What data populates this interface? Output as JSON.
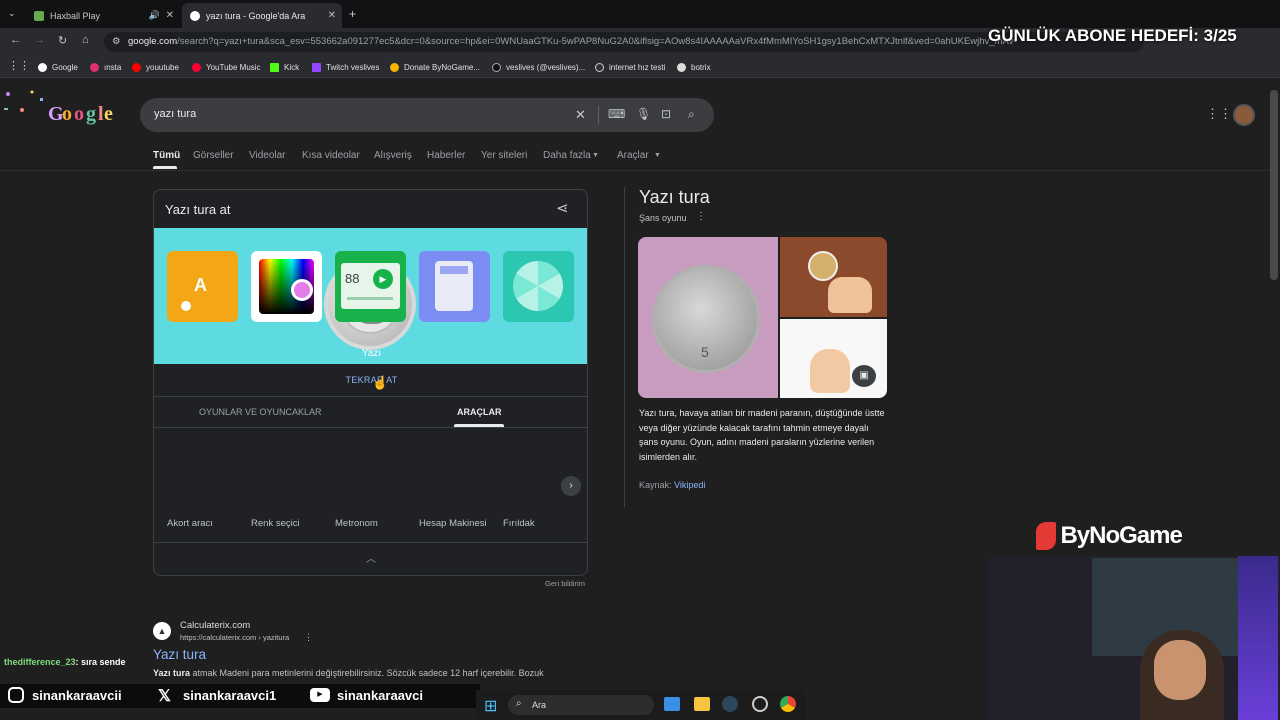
{
  "tabs": [
    {
      "title": "Haxball Play"
    },
    {
      "title": "yazı tura - Google'da Ara"
    }
  ],
  "address": {
    "domain": "google.com",
    "path": "/search?q=yazı+tura&sca_esv=553662a091277ec5&dcr=0&source=hp&ei=0WNUaaGTKu-5wPAP8NuG2A0&iflsig=AOw8s4IAAAAAaVRx4fMmMIYoSH1gsy1BehCxMTXJtnlf&ved=0ahUKEwjhv_mAv-"
  },
  "bookmarks": [
    "Google",
    "ınsta",
    "youutube",
    "YouTube Music",
    "Kick",
    "Twitch veslives",
    "Donate ByNoGame...",
    "veslives (@veslives)...",
    "internet hız testi",
    "botrix"
  ],
  "overlay": {
    "goal": "GÜNLÜK ABONE HEDEFİ: 3/25",
    "brand": "ByNoGame",
    "chat_user": "thedifference_23",
    "chat_msg": ": sıra sende"
  },
  "search": {
    "query": "yazı tura"
  },
  "nav_tabs": [
    "Tümü",
    "Görseller",
    "Videolar",
    "Kısa videolar",
    "Alışveriş",
    "Haberler",
    "Yer siteleri",
    "Daha fazla",
    "Araçlar"
  ],
  "coin_card": {
    "title": "Yazı tura at",
    "result": "Yazı",
    "flip_button": "TEKRAR AT",
    "tab_games": "OYUNLAR VE OYUNCAKLAR",
    "tab_tools": "ARAÇLAR",
    "tools": [
      "Akort aracı",
      "Renk seçici",
      "Metronom",
      "Hesap Makinesi",
      "Fırıldak"
    ],
    "metronome_value": "88",
    "tuner_letter": "A",
    "feedback": "Geri bildirim"
  },
  "knowledge_panel": {
    "title": "Yazı tura",
    "subtitle": "Şans oyunu",
    "coin_digit": "5",
    "description": "Yazı tura, havaya atılan bir madeni paranın, düştüğünde üstte veya diğer yüzünde kalacak tarafını tahmin etmeye dayalı şans oyunu. Oyun, adını madeni paraların yüzlerine verilen isimlerden alır.",
    "source_label": "Kaynak:",
    "source_link": "Vikipedi"
  },
  "result1": {
    "site": "Calculaterix.com",
    "url": "https://calculaterix.com › yazitura",
    "title": "Yazı tura",
    "snippet_bold": "Yazı tura",
    "snippet": " atmak Madeni para metinlerini değiştirebilirsiniz. Sözcük sadece 12 harf içerebilir. Bozuk"
  },
  "social": [
    {
      "icon": "instagram-icon",
      "handle": "sinankaraavcii"
    },
    {
      "icon": "x-icon",
      "handle": "sinankaraavci1"
    },
    {
      "icon": "youtube-icon",
      "handle": "sinankaraavci"
    }
  ],
  "taskbar": {
    "search_placeholder": "Ara"
  },
  "colors": {
    "accent_blue": "#8ab4f8",
    "coin_bg": "#5ddbe0",
    "page_bg": "#1f1f1f"
  }
}
